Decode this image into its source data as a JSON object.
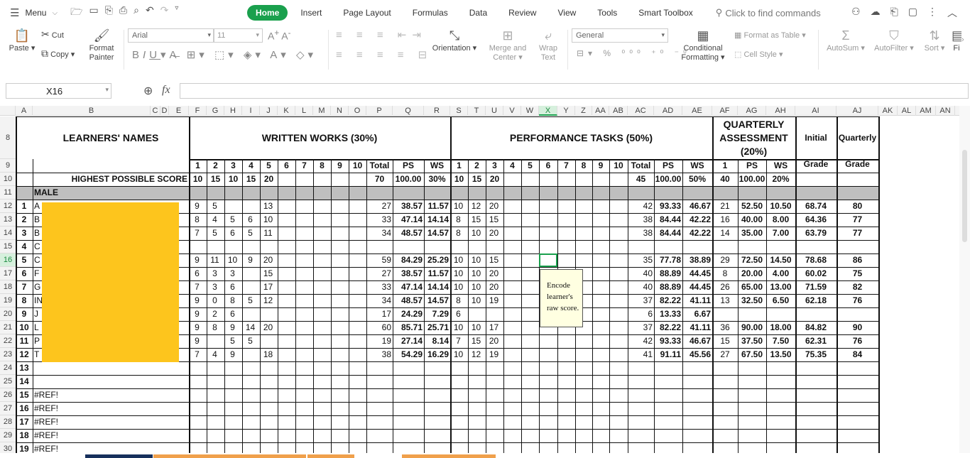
{
  "menubar": {
    "menu_label": "Menu",
    "tabs": [
      "Home",
      "Insert",
      "Page Layout",
      "Formulas",
      "Data",
      "Review",
      "View",
      "Tools",
      "Smart Toolbox"
    ],
    "active_tab": "Home",
    "find_commands": "Click to find commands"
  },
  "ribbon": {
    "paste": "Paste",
    "cut": "Cut",
    "copy": "Copy",
    "format_painter_1": "Format",
    "format_painter_2": "Painter",
    "font_name": "Arial",
    "font_size": "11",
    "orientation": "Orientation",
    "merge_1": "Merge and",
    "merge_2": "Center",
    "wrap_1": "Wrap",
    "wrap_2": "Text",
    "number_format": "General",
    "conditional_1": "Conditional",
    "conditional_2": "Formatting",
    "format_as_table": "Format as Table",
    "cell_style": "Cell Style",
    "autosum": "AutoSum",
    "autofilter": "AutoFilter",
    "sort": "Sort",
    "fill": "Fi"
  },
  "formula_bar": {
    "name_box": "X16",
    "fx": "fx",
    "content": ""
  },
  "columns": [
    "A",
    "B",
    "C",
    "D",
    "E",
    "F",
    "G",
    "H",
    "I",
    "J",
    "K",
    "L",
    "M",
    "N",
    "O",
    "P",
    "Q",
    "R",
    "S",
    "T",
    "U",
    "V",
    "W",
    "X",
    "Y",
    "Z",
    "AA",
    "AB",
    "AC",
    "AD",
    "AE",
    "AF",
    "AG",
    "AH",
    "AI",
    "AJ",
    "AK",
    "AL",
    "AM",
    "AN"
  ],
  "selected_column": "X",
  "rows": [
    "8",
    "9",
    "10",
    "11",
    "12",
    "13",
    "14",
    "15",
    "16",
    "17",
    "18",
    "19",
    "20",
    "21",
    "22",
    "23",
    "24",
    "25",
    "26",
    "27",
    "28",
    "29",
    "30"
  ],
  "selected_row": "16",
  "headers": {
    "learners_names": "LEARNERS' NAMES",
    "written_works": "WRITTEN WORKS (30%)",
    "performance_tasks": "PERFORMANCE TASKS (50%)",
    "quarterly_1": "QUARTERLY",
    "quarterly_2": "ASSESSMENT",
    "quarterly_3": "(20%)",
    "initial": "Initial",
    "quarterly": "Quarterly",
    "grade1": "Grade",
    "grade2": "Grade",
    "hps_label": "HIGHEST POSSIBLE SCORE",
    "male": "MALE"
  },
  "row9_ww": [
    "1",
    "2",
    "3",
    "4",
    "5",
    "6",
    "7",
    "8",
    "9",
    "10",
    "Total",
    "PS",
    "WS"
  ],
  "row9_pt": [
    "1",
    "2",
    "3",
    "4",
    "5",
    "6",
    "7",
    "8",
    "9",
    "10",
    "Total",
    "PS",
    "WS"
  ],
  "row9_qa": [
    "1",
    "PS",
    "WS"
  ],
  "hps": {
    "ww": [
      "10",
      "15",
      "10",
      "15",
      "20",
      "",
      "",
      "",
      "",
      "",
      "70",
      "100.00",
      "30%"
    ],
    "pt": [
      "10",
      "15",
      "20",
      "",
      "",
      "",
      "",
      "",
      "",
      "",
      "45",
      "100.00",
      "50%"
    ],
    "qa": [
      "40",
      "100.00",
      "20%"
    ]
  },
  "learners": [
    {
      "no": "1",
      "init": "A",
      "ww": [
        "9",
        "5",
        "",
        "",
        "13",
        "",
        "",
        "",
        "",
        "",
        "27",
        "38.57",
        "11.57"
      ],
      "pt": [
        "10",
        "12",
        "20",
        "",
        "",
        "",
        "",
        "",
        "",
        "",
        "42",
        "93.33",
        "46.67"
      ],
      "qa": [
        "21",
        "52.50",
        "10.50"
      ],
      "ig": "68.74",
      "qg": "80"
    },
    {
      "no": "2",
      "init": "B",
      "ww": [
        "8",
        "4",
        "5",
        "6",
        "10",
        "",
        "",
        "",
        "",
        "",
        "33",
        "47.14",
        "14.14"
      ],
      "pt": [
        "8",
        "15",
        "15",
        "",
        "",
        "",
        "",
        "",
        "",
        "",
        "38",
        "84.44",
        "42.22"
      ],
      "qa": [
        "16",
        "40.00",
        "8.00"
      ],
      "ig": "64.36",
      "qg": "77"
    },
    {
      "no": "3",
      "init": "B",
      "ww": [
        "7",
        "5",
        "6",
        "5",
        "11",
        "",
        "",
        "",
        "",
        "",
        "34",
        "48.57",
        "14.57"
      ],
      "pt": [
        "8",
        "10",
        "20",
        "",
        "",
        "",
        "",
        "",
        "",
        "",
        "38",
        "84.44",
        "42.22"
      ],
      "qa": [
        "14",
        "35.00",
        "7.00"
      ],
      "ig": "63.79",
      "qg": "77"
    },
    {
      "no": "4",
      "init": "C",
      "ww": [
        "",
        "",
        "",
        "",
        "",
        "",
        "",
        "",
        "",
        "",
        "",
        "",
        ""
      ],
      "pt": [
        "",
        "",
        "",
        "",
        "",
        "",
        "",
        "",
        "",
        "",
        "",
        "",
        ""
      ],
      "qa": [
        "",
        "",
        ""
      ],
      "ig": "",
      "qg": ""
    },
    {
      "no": "5",
      "init": "C",
      "ww": [
        "9",
        "11",
        "10",
        "9",
        "20",
        "",
        "",
        "",
        "",
        "",
        "59",
        "84.29",
        "25.29"
      ],
      "pt": [
        "10",
        "10",
        "15",
        "",
        "",
        "",
        "",
        "",
        "",
        "",
        "35",
        "77.78",
        "38.89"
      ],
      "qa": [
        "29",
        "72.50",
        "14.50"
      ],
      "ig": "78.68",
      "qg": "86"
    },
    {
      "no": "6",
      "init": "F",
      "ww": [
        "6",
        "3",
        "3",
        "",
        "15",
        "",
        "",
        "",
        "",
        "",
        "27",
        "38.57",
        "11.57"
      ],
      "pt": [
        "10",
        "10",
        "20",
        "",
        "",
        "",
        "",
        "",
        "",
        "",
        "40",
        "88.89",
        "44.45"
      ],
      "qa": [
        "8",
        "20.00",
        "4.00"
      ],
      "ig": "60.02",
      "qg": "75"
    },
    {
      "no": "7",
      "init": "G",
      "ww": [
        "7",
        "3",
        "6",
        "",
        "17",
        "",
        "",
        "",
        "",
        "",
        "33",
        "47.14",
        "14.14"
      ],
      "pt": [
        "10",
        "10",
        "20",
        "",
        "",
        "",
        "",
        "",
        "",
        "",
        "40",
        "88.89",
        "44.45"
      ],
      "qa": [
        "26",
        "65.00",
        "13.00"
      ],
      "ig": "71.59",
      "qg": "82"
    },
    {
      "no": "8",
      "init": "IN",
      "ww": [
        "9",
        "0",
        "8",
        "5",
        "12",
        "",
        "",
        "",
        "",
        "",
        "34",
        "48.57",
        "14.57"
      ],
      "pt": [
        "8",
        "10",
        "19",
        "",
        "",
        "",
        "",
        "",
        "",
        "",
        "37",
        "82.22",
        "41.11"
      ],
      "qa": [
        "13",
        "32.50",
        "6.50"
      ],
      "ig": "62.18",
      "qg": "76"
    },
    {
      "no": "9",
      "init": "J",
      "ww": [
        "9",
        "2",
        "6",
        "",
        "",
        "",
        "",
        "",
        "",
        "",
        "17",
        "24.29",
        "7.29"
      ],
      "pt": [
        "6",
        "",
        "",
        "",
        "",
        "",
        "",
        "",
        "",
        "",
        "6",
        "13.33",
        "6.67"
      ],
      "qa": [
        "",
        "",
        ""
      ],
      "ig": "",
      "qg": ""
    },
    {
      "no": "10",
      "init": "L",
      "ww": [
        "9",
        "8",
        "9",
        "14",
        "20",
        "",
        "",
        "",
        "",
        "",
        "60",
        "85.71",
        "25.71"
      ],
      "pt": [
        "10",
        "10",
        "17",
        "",
        "",
        "",
        "",
        "",
        "",
        "",
        "37",
        "82.22",
        "41.11"
      ],
      "qa": [
        "36",
        "90.00",
        "18.00"
      ],
      "ig": "84.82",
      "qg": "90"
    },
    {
      "no": "11",
      "init": "P",
      "ww": [
        "9",
        "",
        "5",
        "5",
        "",
        "",
        "",
        "",
        "",
        "",
        "19",
        "27.14",
        "8.14"
      ],
      "pt": [
        "7",
        "15",
        "20",
        "",
        "",
        "",
        "",
        "",
        "",
        "",
        "42",
        "93.33",
        "46.67"
      ],
      "qa": [
        "15",
        "37.50",
        "7.50"
      ],
      "ig": "62.31",
      "qg": "76"
    },
    {
      "no": "12",
      "init": "T",
      "ww": [
        "7",
        "4",
        "9",
        "",
        "18",
        "",
        "",
        "",
        "",
        "",
        "38",
        "54.29",
        "16.29"
      ],
      "pt": [
        "10",
        "12",
        "19",
        "",
        "",
        "",
        "",
        "",
        "",
        "",
        "41",
        "91.11",
        "45.56"
      ],
      "qa": [
        "27",
        "67.50",
        "13.50"
      ],
      "ig": "75.35",
      "qg": "84"
    }
  ],
  "extra_rows": [
    {
      "no": "13",
      "name": ""
    },
    {
      "no": "14",
      "name": ""
    },
    {
      "no": "15",
      "name": "#REF!"
    },
    {
      "no": "16",
      "name": "#REF!"
    },
    {
      "no": "17",
      "name": "#REF!"
    },
    {
      "no": "18",
      "name": "#REF!"
    },
    {
      "no": "19",
      "name": "#REF!"
    }
  ],
  "comment": "Encode learner's raw score."
}
